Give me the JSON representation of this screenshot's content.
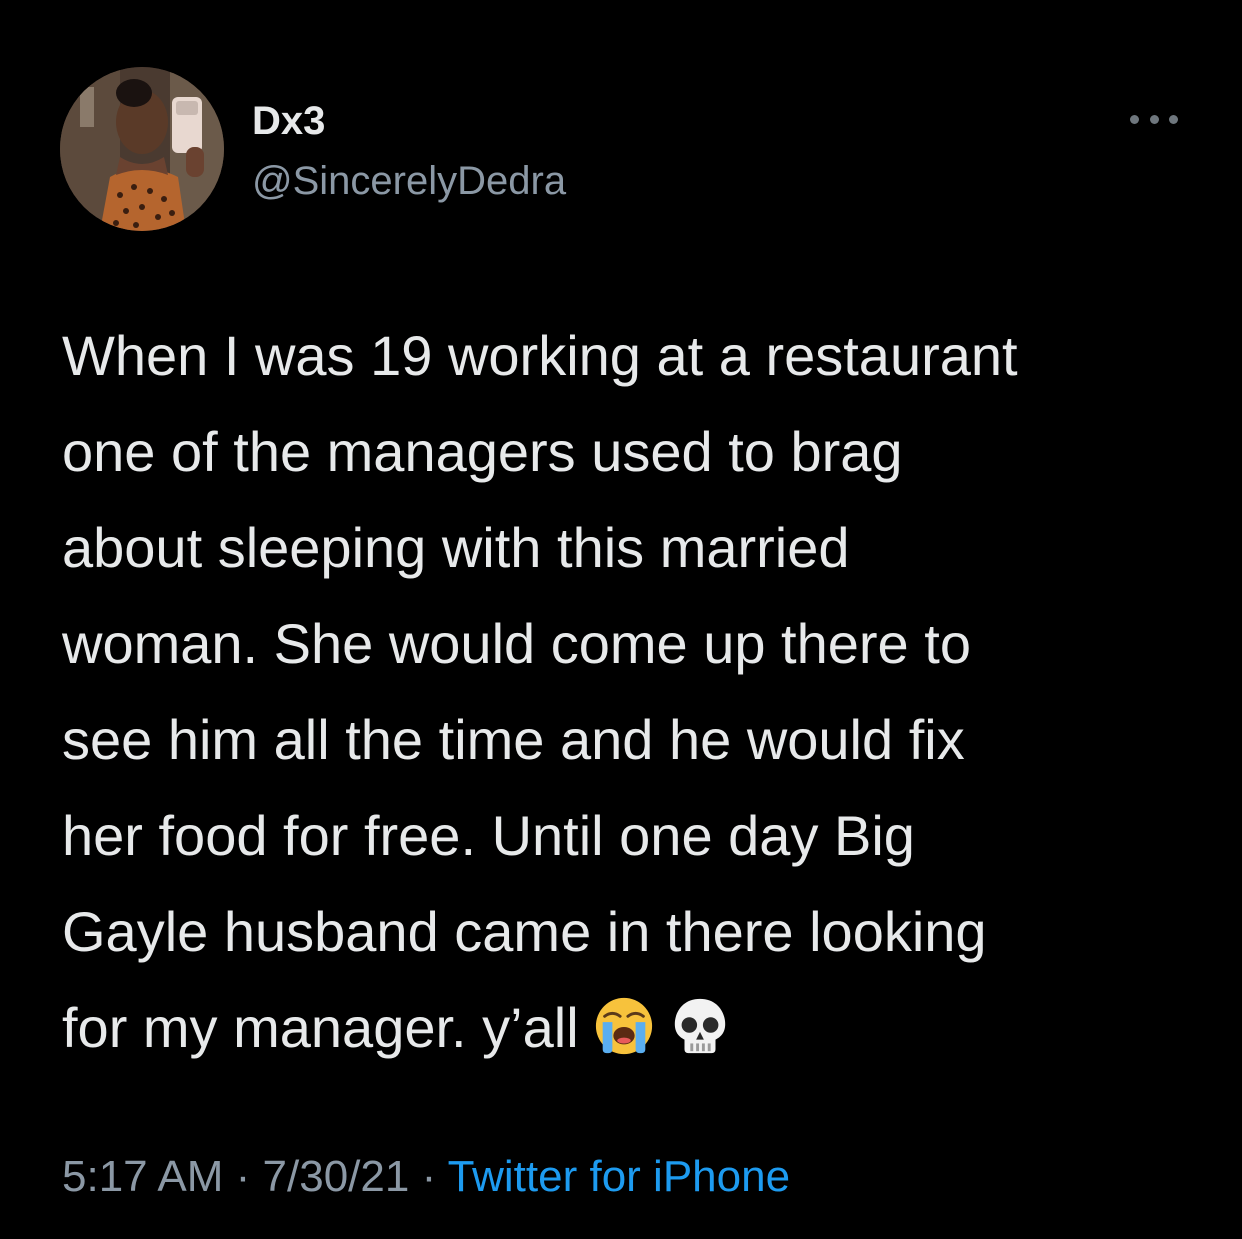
{
  "user": {
    "display_name": "Dx3",
    "handle": "@SincerelyDedra",
    "avatar_icon": "profile-photo"
  },
  "more_icon": "more-horizontal-icon",
  "tweet": {
    "lines": [
      "When I was 19 working at a restaurant",
      "one of the managers used to brag",
      "about sleeping with this married",
      "woman. She would come up there to",
      "see him all the time and he would fix",
      "her food for free. Until one day Big",
      "Gayle husband came in there looking",
      "for my manager. y’all"
    ],
    "emojis": [
      "loudly-crying-face-emoji",
      "skull-emoji"
    ]
  },
  "meta": {
    "time": "5:17 AM",
    "separator1": " · ",
    "date": "7/30/21",
    "separator2": " · ",
    "source": "Twitter for iPhone"
  },
  "colors": {
    "background": "#000000",
    "primary_text": "#e7e9ea",
    "secondary_text": "#8b98a5",
    "link": "#1d9bf0"
  }
}
